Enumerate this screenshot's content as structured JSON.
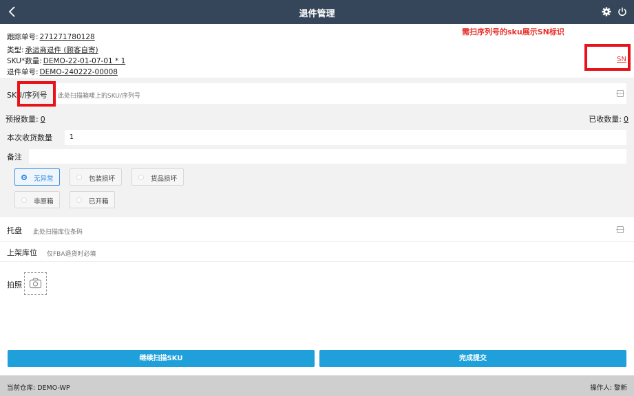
{
  "header": {
    "title": "退件管理"
  },
  "info": {
    "tracking_label": "跟踪单号:",
    "tracking_value": "271271780128",
    "type_label": "类型:",
    "type_value": "承运商退件 (顾客自寄)",
    "sku_qty_label": "SKU*数量:",
    "sku_qty_value": "DEMO-22-01-07-01 * 1",
    "return_no_label": "退件单号:",
    "return_no_value": "DEMO-240222-00008"
  },
  "annotation": {
    "text": "需扫序列号的sku展示SN标识",
    "sn_mark": "SN",
    "color": "#e8121b"
  },
  "scan": {
    "label": "SKU/序列号",
    "placeholder": "此处扫描箱唛上的SKU/序列号"
  },
  "counts": {
    "forecast_label": "预报数量:",
    "forecast_value": "0",
    "received_label": "已收数量:",
    "received_value": "0"
  },
  "receive_qty": {
    "label": "本次收货数量",
    "value": "1"
  },
  "remark": {
    "label": "备注",
    "value": ""
  },
  "options": [
    {
      "label": "无异常",
      "selected": true
    },
    {
      "label": "包装损坏",
      "selected": false
    },
    {
      "label": "货品损坏",
      "selected": false
    },
    {
      "label": "非原箱",
      "selected": false
    },
    {
      "label": "已开箱",
      "selected": false
    }
  ],
  "pallet": {
    "label": "托盘",
    "placeholder": "此处扫描库位条码"
  },
  "location": {
    "label": "上架库位",
    "placeholder": "仅FBA退货时必填"
  },
  "photo": {
    "label": "拍照"
  },
  "buttons": {
    "continue": "继续扫描SKU",
    "finish": "完成提交"
  },
  "footer": {
    "warehouse": "当前仓库: DEMO-WP",
    "operator": "操作人: 黎新"
  },
  "colors": {
    "header_bg": "#36465a",
    "accent": "#1fa0db",
    "annotation": "#e8322b"
  }
}
